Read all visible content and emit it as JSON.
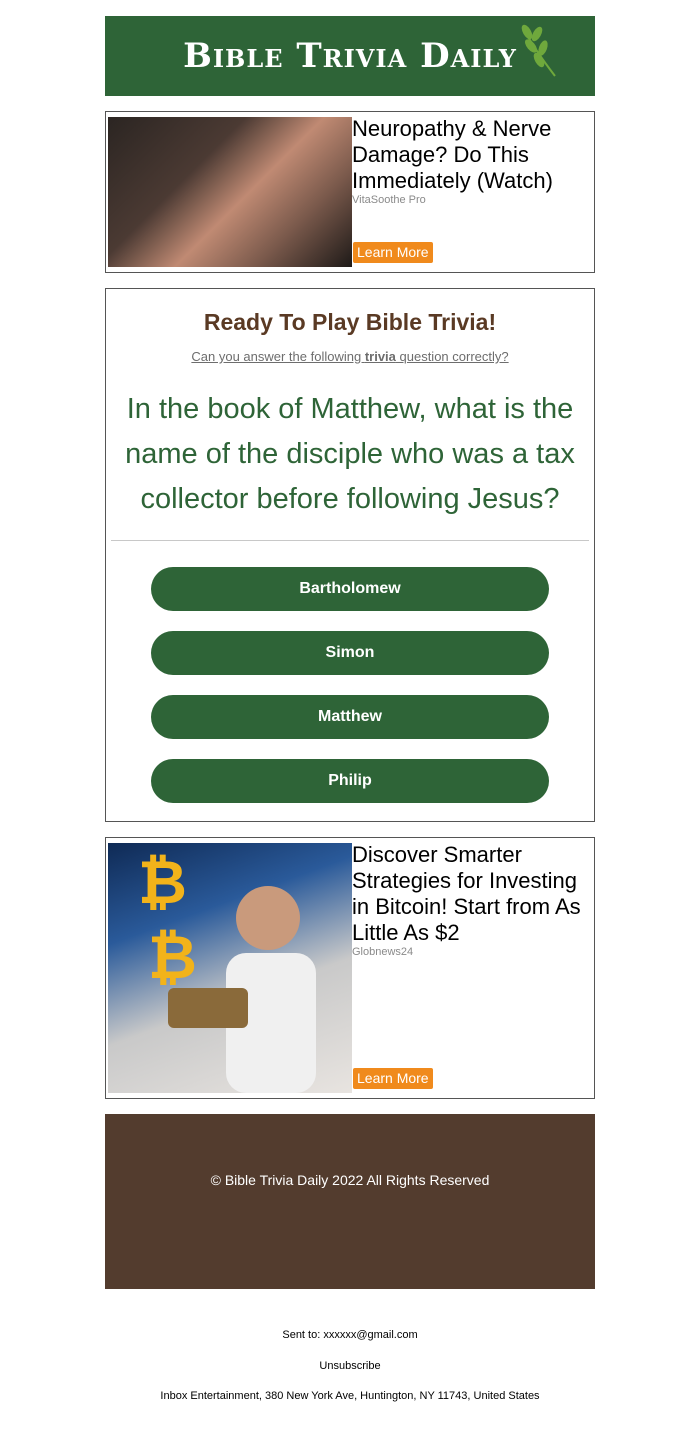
{
  "header": {
    "logo_text": "Bible Trivia Daily"
  },
  "ad1": {
    "title": "Neuropathy & Nerve Damage? Do This Immediately (Watch)",
    "source": "VitaSoothe Pro",
    "cta": "Learn More"
  },
  "trivia": {
    "heading": "Ready To Play Bible Trivia!",
    "sub_prefix": "Can you answer the following ",
    "sub_bold": "trivia",
    "sub_suffix": " question correctly?",
    "question": "In the book of Matthew, what is the name of the disciple who was a tax collector before following Jesus?",
    "answers": [
      "Bartholomew",
      "Simon",
      "Matthew",
      "Philip"
    ]
  },
  "ad2": {
    "title": "Discover Smarter Strategies for Investing in Bitcoin! Start from As Little As $2",
    "source": "Globnews24",
    "cta": "Learn More"
  },
  "footer": {
    "copyright": "© Bible Trivia Daily 2022 All Rights Reserved"
  },
  "meta": {
    "sent_to": "Sent to: xxxxxx@gmail.com",
    "unsubscribe": "Unsubscribe",
    "address": "Inbox Entertainment, 380 New York Ave, Huntington, NY 11743, United States"
  },
  "colors": {
    "brand_green": "#2e6437",
    "brown": "#533c2e",
    "cta_orange": "#f08a1c"
  }
}
